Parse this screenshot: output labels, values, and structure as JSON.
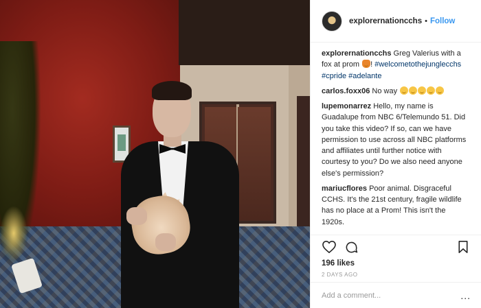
{
  "post": {
    "username": "explorernationcchs",
    "separator": "•",
    "follow_label": "Follow",
    "caption": {
      "username": "explorernationcchs",
      "text": "Greg Valerius with a fox at prom",
      "emoji": "fox-face-icon",
      "after_emoji": "! ",
      "hashtags": [
        "#welcometothejunglecchs",
        "#cpride",
        "#adelante"
      ]
    },
    "comments": [
      {
        "username": "carlos.foxx06",
        "text": "No way",
        "emojis": [
          "laughing-tears-icon",
          "laughing-tears-icon",
          "laughing-tears-icon",
          "laughing-tears-icon",
          "laughing-tears-icon"
        ]
      },
      {
        "username": "lupemonarrez",
        "text": "Hello, my name is Guadalupe from NBC 6/Telemundo 51. Did you take this video? If so, can we have permission to use across all NBC platforms and affiliates until further notice with courtesy to you? Do we also need anyone else's permission?"
      },
      {
        "username": "mariucflores",
        "text": "Poor animal. Disgraceful CCHS. It's the 21st century, fragile wildlife has no place at a Prom! This isn't the 1920s."
      }
    ],
    "likes": "196 likes",
    "time_ago": "2 DAYS AGO",
    "add_comment_placeholder": "Add a comment...",
    "more_label": "..."
  },
  "colors": {
    "follow": "#3897f0",
    "hashtag": "#003569",
    "muted": "#999999",
    "text": "#262626"
  }
}
